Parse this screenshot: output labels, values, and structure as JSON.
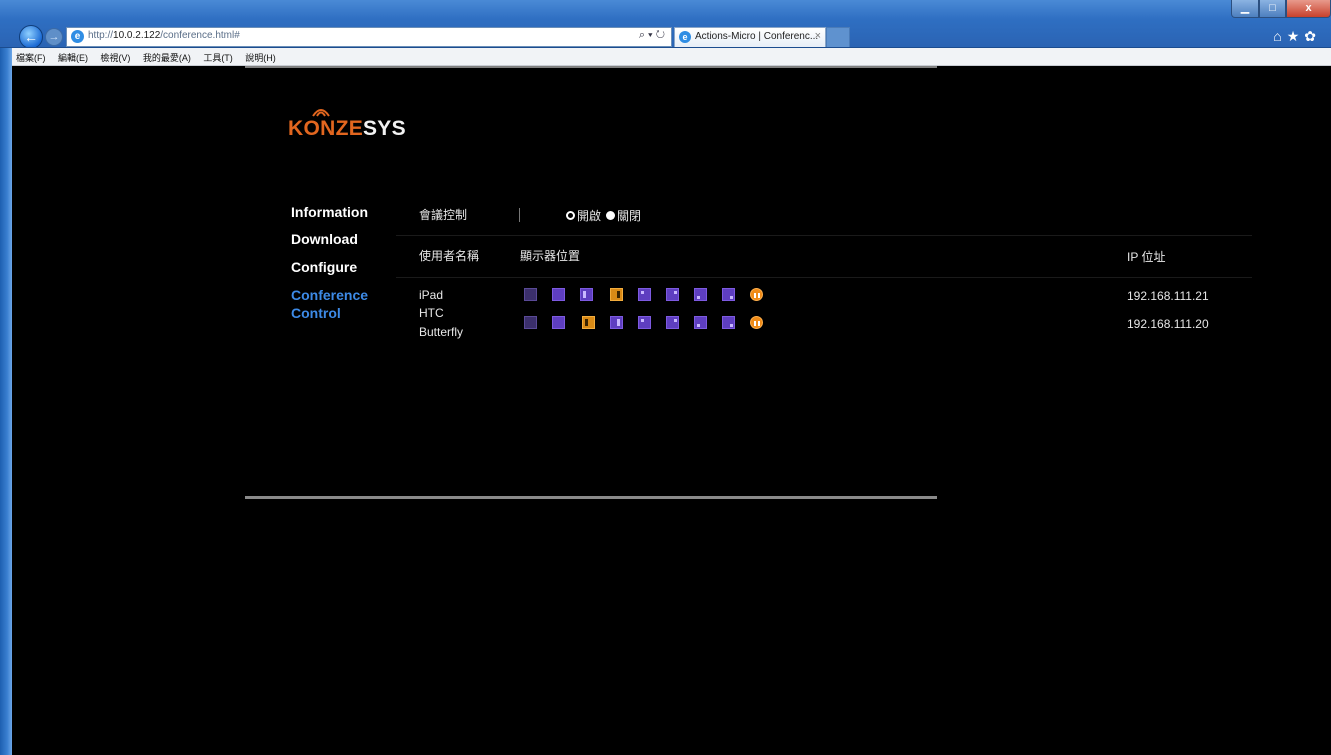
{
  "browser": {
    "url_prefix": "http://",
    "url_host": "10.0.2.122",
    "url_path": "/conference.html#",
    "addr_controls": "⌕ ▾ ↻",
    "tab_title": "Actions-Micro | Conferenc...",
    "tab_close": "×",
    "back": "←",
    "forward": "→",
    "minimize": "▁",
    "maximize": "□",
    "close": "x",
    "toolbar_icons": "⌂★✿",
    "menu": [
      "檔案(F)",
      "編輯(E)",
      "檢視(V)",
      "我的最愛(A)",
      "工具(T)",
      "說明(H)"
    ]
  },
  "logo": {
    "k_part": "KONZE",
    "s_part": "SYS"
  },
  "nav": [
    {
      "label": "Information"
    },
    {
      "label": "Download"
    },
    {
      "label": "Configure"
    },
    {
      "label": "Conference Control"
    }
  ],
  "conference": {
    "control_label": "會議控制",
    "on_label": "開啟",
    "off_label": "關閉",
    "col_user": "使用者名稱",
    "col_display": "顯示器位置",
    "col_ip": "IP 位址",
    "rows": [
      {
        "name": "iPad",
        "ip": "192.168.111.21"
      },
      {
        "name": "HTC Butterfly",
        "name_line1": "HTC",
        "name_line2": "Butterfly",
        "ip": "192.168.111.20"
      }
    ]
  },
  "icon_colors": {
    "accent": "#3d8ae6",
    "brand_orange": "#e2661f",
    "purple": "#5e3ec0",
    "orange": "#d98a16"
  }
}
